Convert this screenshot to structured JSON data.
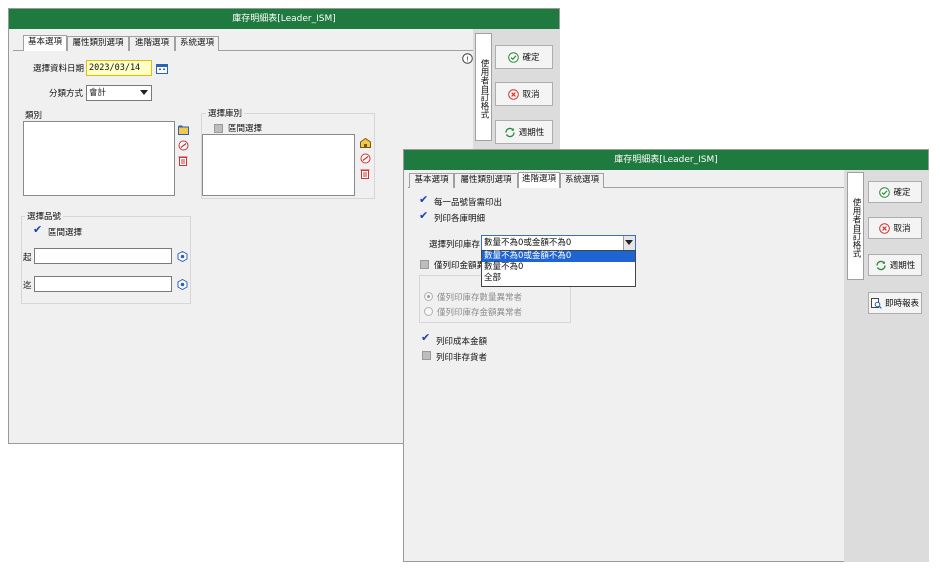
{
  "back": {
    "title": "庫存明細表[Leader_ISM]",
    "tabs": [
      "基本選項",
      "屬性類別選項",
      "進階選項",
      "系統選項"
    ],
    "date_label": "選擇資料日期",
    "date_value": "2023/03/14",
    "classify_label": "分類方式",
    "classify_value": "會計",
    "category_label": "類別",
    "warehouse_label": "選擇庫別",
    "warehouse_range": "區間選擇",
    "product_label": "選擇品號",
    "product_range": "區間選擇",
    "from_label": "起",
    "to_label": "迄",
    "from_value": "",
    "to_value": "",
    "side_tab": "使用者自訂格式",
    "ok": "確定",
    "cancel": "取消",
    "periodic": "週期性"
  },
  "front": {
    "title": "庫存明細表[Leader_ISM]",
    "tabs": [
      "基本選項",
      "屬性類別選項",
      "進階選項",
      "系統選項"
    ],
    "print_each": "每一品號皆需印出",
    "print_warehouse_detail": "列印各庫明細",
    "select_stock_label": "選擇列印庫存",
    "select_stock_value": "數量不為0或金額不為0",
    "stock_options": [
      "數量不為0或金額不為0",
      "數量不為0",
      "全部"
    ],
    "print_abnormal_amount": "僅列印金額異",
    "radio_qty": "僅列印庫存數量異常者",
    "radio_amt": "僅列印庫存金額異常者",
    "print_cost": "列印成本金額",
    "print_no_stock": "列印非存貨者",
    "side_tab": "使用者自訂格式",
    "ok": "確定",
    "cancel": "取消",
    "periodic": "週期性",
    "instant_report": "即時報表"
  },
  "colors": {
    "titlebar": "#1f7a3f",
    "selection": "#1e64d2",
    "date_bg": "#ffffc8"
  }
}
